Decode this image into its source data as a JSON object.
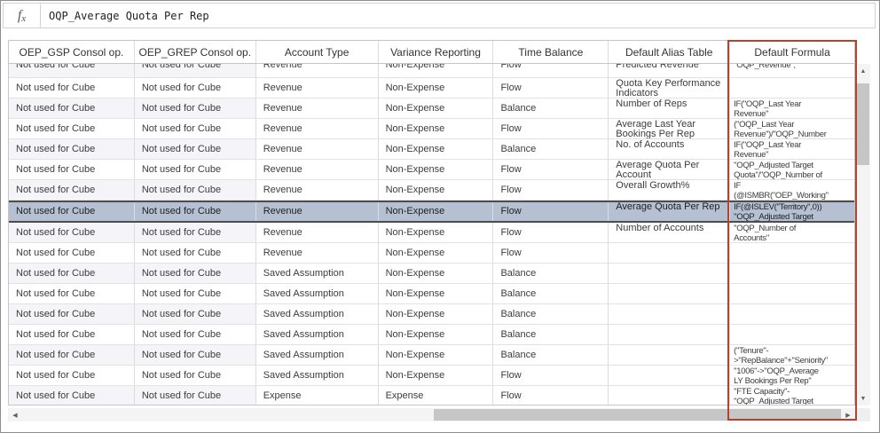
{
  "formula_bar": {
    "fx_icon_f": "f",
    "fx_icon_x": "x",
    "value": "OQP_Average Quota Per Rep"
  },
  "table": {
    "columns": [
      "OEP_GSP Consol op.",
      "OEP_GREP Consol op.",
      "Account Type",
      "Variance Reporting",
      "Time Balance",
      "Default Alias Table",
      "Default Formula"
    ],
    "highlighted_column": "Default Formula",
    "selected_member": "Average Quota Per Rep",
    "rows": [
      {
        "partial": true,
        "cells": [
          "Not used for Cube",
          "Not used for Cube",
          "Revenue",
          "Non-Expense",
          "Flow",
          "Predicted Revenue",
          "\"OQP_Revenue\";"
        ]
      },
      {
        "cells": [
          "Not used for Cube",
          "Not used for Cube",
          "Revenue",
          "Non-Expense",
          "Flow",
          "Quota Key Performance Indicators",
          ""
        ]
      },
      {
        "cells": [
          "Not used for Cube",
          "Not used for Cube",
          "Revenue",
          "Non-Expense",
          "Balance",
          "Number of Reps",
          "IF(\"OQP_Last Year\nRevenue\""
        ]
      },
      {
        "cells": [
          "Not used for Cube",
          "Not used for Cube",
          "Revenue",
          "Non-Expense",
          "Flow",
          "Average Last Year Bookings Per Rep",
          "(\"OQP_Last Year\nRevenue\")/\"OQP_Number"
        ]
      },
      {
        "cells": [
          "Not used for Cube",
          "Not used for Cube",
          "Revenue",
          "Non-Expense",
          "Balance",
          "No. of Accounts",
          "IF(\"OQP_Last Year\nRevenue\""
        ]
      },
      {
        "cells": [
          "Not used for Cube",
          "Not used for Cube",
          "Revenue",
          "Non-Expense",
          "Flow",
          "Average Quota Per Account",
          "\"OQP_Adjusted Target\nQuota\"/\"OQP_Number of"
        ]
      },
      {
        "cells": [
          "Not used for Cube",
          "Not used for Cube",
          "Revenue",
          "Non-Expense",
          "Flow",
          "Overall Growth%",
          "IF\n(@ISMBR(\"OEP_Working\""
        ]
      },
      {
        "selected": true,
        "cells": [
          "Not used for Cube",
          "Not used for Cube",
          "Revenue",
          "Non-Expense",
          "Flow",
          "Average Quota Per Rep",
          "IF(@ISLEV(\"Territory\",0))\n\"OQP_Adjusted Target"
        ]
      },
      {
        "cells": [
          "Not used for Cube",
          "Not used for Cube",
          "Revenue",
          "Non-Expense",
          "Flow",
          "Number of Accounts",
          "\"OQP_Number of\nAccounts\""
        ]
      },
      {
        "cells": [
          "Not used for Cube",
          "Not used for Cube",
          "Revenue",
          "Non-Expense",
          "Flow",
          "",
          ""
        ]
      },
      {
        "cells": [
          "Not used for Cube",
          "Not used for Cube",
          "Saved Assumption",
          "Non-Expense",
          "Balance",
          "",
          ""
        ]
      },
      {
        "cells": [
          "Not used for Cube",
          "Not used for Cube",
          "Saved Assumption",
          "Non-Expense",
          "Balance",
          "",
          ""
        ]
      },
      {
        "cells": [
          "Not used for Cube",
          "Not used for Cube",
          "Saved Assumption",
          "Non-Expense",
          "Balance",
          "",
          ""
        ]
      },
      {
        "cells": [
          "Not used for Cube",
          "Not used for Cube",
          "Saved Assumption",
          "Non-Expense",
          "Balance",
          "",
          ""
        ]
      },
      {
        "cells": [
          "Not used for Cube",
          "Not used for Cube",
          "Saved Assumption",
          "Non-Expense",
          "Balance",
          "",
          "(\"Tenure\"-\n>\"RepBalance\"+\"Seniority\""
        ]
      },
      {
        "cells": [
          "Not used for Cube",
          "Not used for Cube",
          "Saved Assumption",
          "Non-Expense",
          "Flow",
          "",
          "\"1006\"->\"OQP_Average\nLY Bookings Per Rep\""
        ]
      },
      {
        "cells": [
          "Not used for Cube",
          "Not used for Cube",
          "Expense",
          "Expense",
          "Flow",
          "",
          "\"FTE Capacity\"-\n\"OQP_Adjusted Target"
        ]
      }
    ]
  },
  "icons": {
    "scroll_up": "▲",
    "scroll_down": "▼",
    "scroll_left": "◀",
    "scroll_right": "▶"
  },
  "colors": {
    "selected_row_bg": "#b5c1d3",
    "highlight_border": "#b0452c"
  }
}
